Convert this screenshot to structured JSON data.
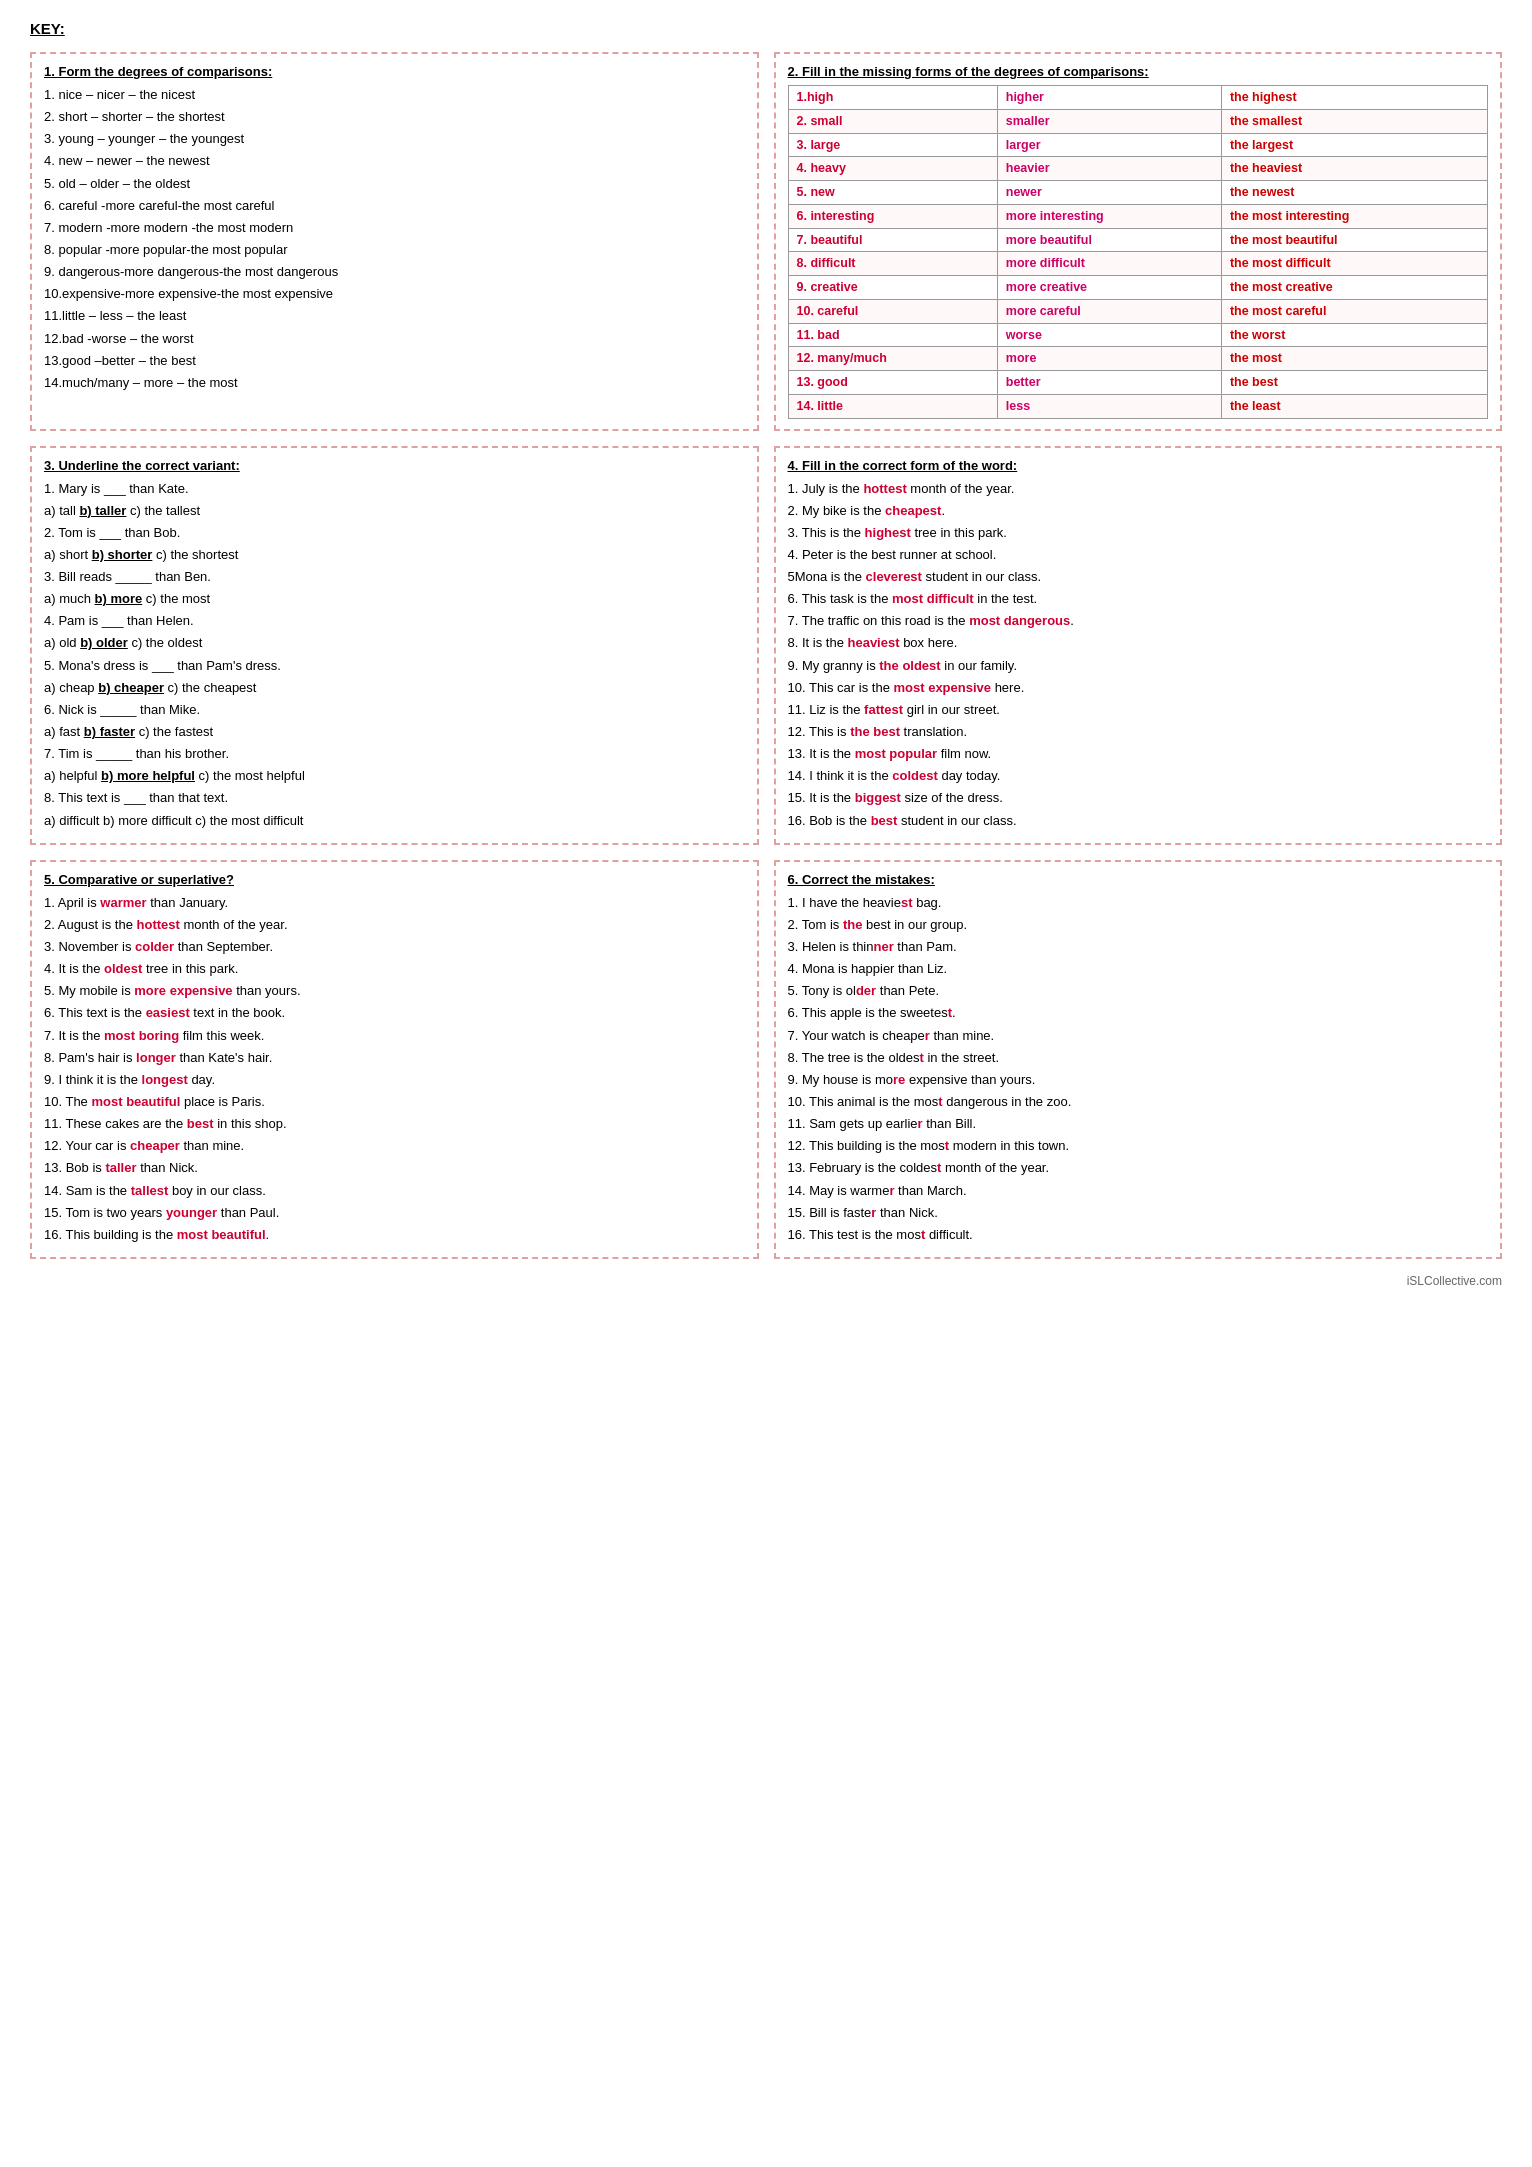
{
  "title": "KEY:",
  "section1": {
    "title": "1. Form the degrees of comparisons:",
    "lines": [
      "1. nice – nicer – the nicest",
      "2. short – shorter – the shortest",
      "3. young – younger – the youngest",
      "4. new – newer – the newest",
      "5. old – older – the oldest",
      "6. careful -more careful-the most careful",
      "7. modern -more modern -the most modern",
      "8. popular -more popular-the most popular",
      "9. dangerous-more dangerous-the most dangerous",
      "10.expensive-more expensive-the most expensive",
      "11.little – less – the least",
      "12.bad -worse – the worst",
      "13.good –better – the best",
      "14.much/many – more – the most"
    ]
  },
  "section2": {
    "title": "2. Fill in the missing forms of the degrees of comparisons:",
    "rows": [
      {
        "base": "1.high",
        "comp": "higher",
        "superl": "the highest"
      },
      {
        "base": "2. small",
        "comp": "smaller",
        "superl": "the smallest"
      },
      {
        "base": "3. large",
        "comp": "larger",
        "superl": "the largest"
      },
      {
        "base": "4. heavy",
        "comp": "heavier",
        "superl": "the heaviest"
      },
      {
        "base": "5. new",
        "comp": "newer",
        "superl": "the newest"
      },
      {
        "base": "6. interesting",
        "comp": "more interesting",
        "superl": "the most interesting"
      },
      {
        "base": "7. beautiful",
        "comp": "more beautiful",
        "superl": "the most beautiful"
      },
      {
        "base": "8. difficult",
        "comp": "more difficult",
        "superl": "the most difficult"
      },
      {
        "base": "9. creative",
        "comp": "more creative",
        "superl": "the most creative"
      },
      {
        "base": "10. careful",
        "comp": "more careful",
        "superl": "the most careful"
      },
      {
        "base": "11. bad",
        "comp": "worse",
        "superl": "the worst"
      },
      {
        "base": "12. many/much",
        "comp": "more",
        "superl": "the most"
      },
      {
        "base": "13. good",
        "comp": "better",
        "superl": "the best"
      },
      {
        "base": "14. little",
        "comp": "less",
        "superl": "the least"
      }
    ]
  },
  "section3": {
    "title": "3. Underline the correct variant:",
    "lines": [
      "1. Mary is ___ than Kate.",
      "a) tall  b) taller  c) the tallest",
      "2. Tom is ___ than Bob.",
      "a) short  b) shorter  c) the shortest",
      "3. Bill reads _____ than Ben.",
      "a) much  b) more  c) the most",
      "4. Pam is ___ than Helen.",
      "a) old  b) older  c) the oldest",
      "5. Mona's dress is ___ than Pam's dress.",
      "a) cheap  b) cheaper  c) the cheapest",
      "6. Nick is _____ than Mike.",
      "a) fast  b) faster  c) the fastest",
      "7. Tim is _____ than his brother.",
      "a) helpful  b) more helpful  c) the most helpful",
      "8. This text is ___ than that text.",
      "a) difficult  b) more difficult  c) the most difficult"
    ]
  },
  "section4": {
    "title": "4. Fill in the correct form of the word:",
    "lines": [
      {
        "text": "1. July is the ",
        "highlight": "hottest",
        "rest": " month of the year."
      },
      {
        "text": "2. My bike is the ",
        "highlight": "cheapest",
        "rest": "."
      },
      {
        "text": "3. This is the ",
        "highlight": "highest",
        "rest": " tree in this park."
      },
      {
        "text": "4. Peter is the best runner at school.",
        "highlight": "",
        "rest": ""
      },
      {
        "text": "5Mona is the ",
        "highlight": "cleverest",
        "rest": " student in our class."
      },
      {
        "text": "6. This task is the ",
        "highlight": "most difficult",
        "rest": " in the test."
      },
      {
        "text": "7. The traffic on this road is the ",
        "highlight": "most dangerous",
        "rest": "."
      },
      {
        "text": "8. It is the ",
        "highlight": "heaviest",
        "rest": " box here."
      },
      {
        "text": "9. My granny is ",
        "highlight": "the oldest",
        "rest": " in our family."
      },
      {
        "text": "10. This car is the ",
        "highlight": "most expensive",
        "rest": " here."
      },
      {
        "text": "11. Liz is the ",
        "highlight": "fattest",
        "rest": " girl in our street."
      },
      {
        "text": "12. This is ",
        "highlight": "the best",
        "rest": " translation."
      },
      {
        "text": "13. It is the ",
        "highlight": "most popular",
        "rest": " film now."
      },
      {
        "text": "14. I think it is the ",
        "highlight": "coldest",
        "rest": " day today."
      },
      {
        "text": "15. It is the ",
        "highlight": "biggest",
        "rest": " size of the dress."
      },
      {
        "text": "16. Bob is the ",
        "highlight": "best",
        "rest": " student in our class."
      }
    ]
  },
  "section5": {
    "title": "5. Comparative or superlative?",
    "lines": [
      {
        "pre": "1. April is ",
        "h": "warmer",
        "post": " than January."
      },
      {
        "pre": "2. August is the ",
        "h": "hottest",
        "post": " month of the year."
      },
      {
        "pre": "3. November is ",
        "h": "colder",
        "post": " than September."
      },
      {
        "pre": "4. It is the ",
        "h": "oldest",
        "post": " tree in this park."
      },
      {
        "pre": "5. My mobile is ",
        "h": "more expensive",
        "post": " than yours."
      },
      {
        "pre": "6. This text is the ",
        "h": "easiest",
        "post": " text in the book."
      },
      {
        "pre": "7. It is the ",
        "h": "most boring",
        "post": " film this week."
      },
      {
        "pre": "8. Pam's hair is ",
        "h": "longer",
        "post": " than Kate's hair."
      },
      {
        "pre": "9. I think it is the ",
        "h": "longest",
        "post": " day."
      },
      {
        "pre": "10. The ",
        "h": "most beautiful",
        "post": " place is Paris."
      },
      {
        "pre": "11. These cakes are the ",
        "h": "best",
        "post": " in this shop."
      },
      {
        "pre": "12. Your car is ",
        "h": "cheaper",
        "post": " than mine."
      },
      {
        "pre": "13. Bob is ",
        "h": "taller",
        "post": " than Nick."
      },
      {
        "pre": "14. Sam is the ",
        "h": "tallest",
        "post": " boy in our class."
      },
      {
        "pre": "15. Tom is two years ",
        "h": "younger",
        "post": " than Paul."
      },
      {
        "pre": "16. This building is the ",
        "h": "most beautiful",
        "post": "."
      }
    ]
  },
  "section6": {
    "title": "6. Correct the mistakes:",
    "lines": [
      "1. I have the heaviest bag.",
      "2. Tom is the best in our group.",
      "3. Helen is thinner than Pam.",
      "4. Mona is happier than Liz.",
      "5. Tony is older than Pete.",
      "6. This apple is the sweetest.",
      "7. Your watch is cheaper than mine.",
      "8. The tree is the oldest in the street.",
      "9. My house is more expensive than yours.",
      "10. This animal is the most dangerous in the zoo.",
      "11. Sam gets up earlier than Bill.",
      "12. This building is the most modern in this town.",
      "13. February is the coldest month of the year.",
      "14. May is warmer than March.",
      "15. Bill is faster than Nick.",
      "16. This test is the most difficult."
    ],
    "highlights": [
      {
        "word": "heaviest",
        "pos": 0
      },
      {
        "word": "the best",
        "pos": 1
      },
      {
        "word": "thinner",
        "pos": 2
      },
      {
        "word": "happier",
        "pos": 3
      },
      {
        "word": "older",
        "pos": 4
      },
      {
        "word": "sweetest",
        "pos": 5
      },
      {
        "word": "cheaper",
        "pos": 6
      },
      {
        "word": "oldest",
        "pos": 7
      },
      {
        "word": "more expensive",
        "pos": 8
      },
      {
        "word": "most dangerous",
        "pos": 9
      },
      {
        "word": "earlier",
        "pos": 10
      },
      {
        "word": "most modern",
        "pos": 11
      },
      {
        "word": "coldest",
        "pos": 12
      },
      {
        "word": "warmer",
        "pos": 13
      },
      {
        "word": "faster",
        "pos": 14
      },
      {
        "word": "most difficult",
        "pos": 15
      }
    ]
  },
  "watermark": "iSLCollective.com"
}
